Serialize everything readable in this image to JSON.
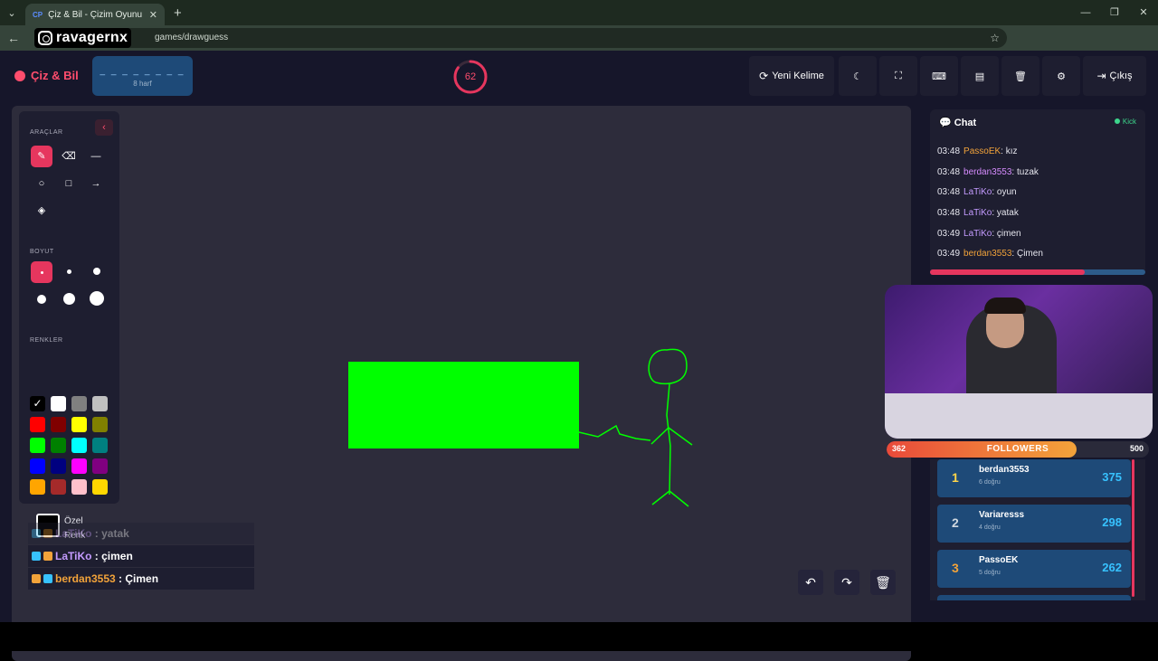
{
  "browser": {
    "tab_title": "Çiz & Bil - Çizim Oyunu",
    "tab_favicon": "CP",
    "url_text": "games/drawguess",
    "watermark": "ravagernx",
    "profile_initial": "E"
  },
  "header": {
    "logo": "Çiz & Bil",
    "word_mask": "_ _ _ _ _ _ _ _",
    "word_count": "8 harf",
    "timer": "62",
    "timer_fraction": 0.85,
    "new_word_label": "Yeni Kelime",
    "logout_label": "Çıkış"
  },
  "tools": {
    "tools_heading": "ARAÇLAR",
    "size_heading": "BOYUT",
    "colors_heading": "RENKLER",
    "custom_color_line1": "Özel",
    "custom_color_line2": "Renk",
    "palette": [
      "#000000",
      "#ffffff",
      "#808080",
      "#c0c0c0",
      "#ff0000",
      "#800000",
      "#ffff00",
      "#808000",
      "#00ff00",
      "#008000",
      "#00ffff",
      "#008080",
      "#0000ff",
      "#000080",
      "#ff00ff",
      "#800080",
      "#ffa500",
      "#a52a2a",
      "#ffc0cb",
      "#ffd700"
    ]
  },
  "guess_feed": [
    {
      "user": "LaTiKo",
      "text": "yatak",
      "faded": true
    },
    {
      "user": "LaTiKo",
      "text": "çimen",
      "faded": false
    },
    {
      "user": "berdan3553",
      "text": "Çimen",
      "faded": false
    }
  ],
  "chat": {
    "title": "Chat",
    "platform": "Kick",
    "progress_fraction": 0.72,
    "messages": [
      {
        "time": "03:48",
        "user": "PassoEK",
        "text": "kız",
        "color": "#f2a33a"
      },
      {
        "time": "03:48",
        "user": "berdan3553",
        "text": "tuzak",
        "color": "#d78cff"
      },
      {
        "time": "03:48",
        "user": "LaTiKo",
        "text": "oyun",
        "color": "#c49bff"
      },
      {
        "time": "03:48",
        "user": "LaTiKo",
        "text": "yatak",
        "color": "#c49bff"
      },
      {
        "time": "03:49",
        "user": "LaTiKo",
        "text": "çimen",
        "color": "#c49bff"
      },
      {
        "time": "03:49",
        "user": "berdan3553",
        "text": "Çimen",
        "color": "#f2a33a"
      }
    ]
  },
  "followers": {
    "label": "FOLLOWERS",
    "current": "362",
    "goal": "500",
    "fraction": 0.724
  },
  "leaderboard": [
    {
      "rank": "1",
      "name": "berdan3553",
      "sub": "6 doğru",
      "score": "375",
      "rank_color": "#ffd54a"
    },
    {
      "rank": "2",
      "name": "Variaresss",
      "sub": "4 doğru",
      "score": "298",
      "rank_color": "#d0d8e0"
    },
    {
      "rank": "3",
      "name": "PassoEK",
      "sub": "5 doğru",
      "score": "262",
      "rank_color": "#f2a33a"
    }
  ],
  "colors": {
    "accent": "#e6365e",
    "drawing": "#00ff00"
  }
}
